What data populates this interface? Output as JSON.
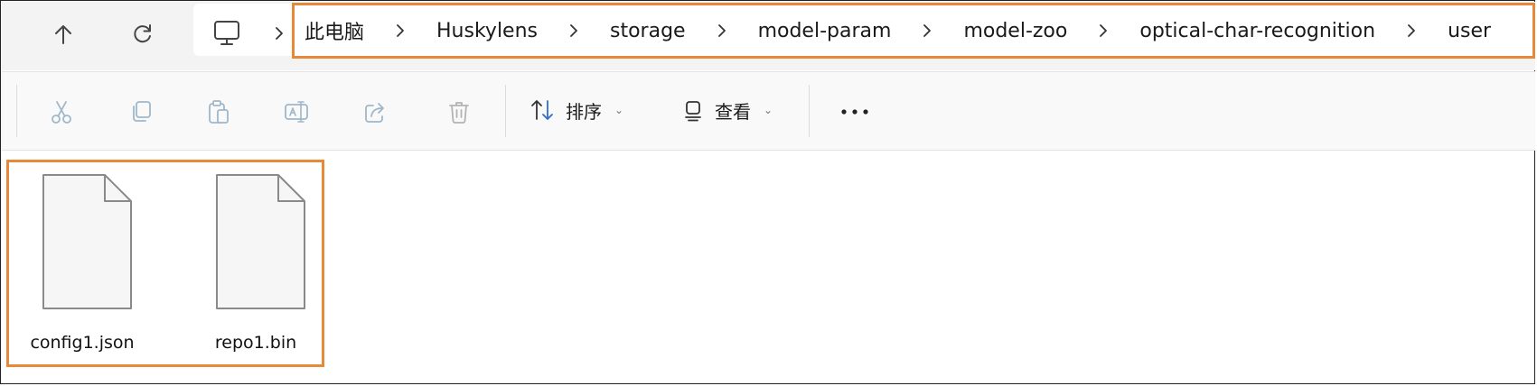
{
  "navigation": {
    "up_icon": "arrow-up-icon",
    "refresh_icon": "refresh-icon",
    "computer_icon": "computer-icon"
  },
  "breadcrumb": [
    "此电脑",
    "Huskylens",
    "storage",
    "model-param",
    "model-zoo",
    "optical-char-recognition",
    "user"
  ],
  "toolbar": {
    "icons": [
      "cut-icon",
      "copy-icon",
      "paste-icon",
      "rename-icon",
      "share-icon",
      "delete-icon"
    ],
    "sort_label": "排序",
    "view_label": "查看",
    "more_label": "···"
  },
  "files": [
    {
      "name": "config1.json",
      "icon": "file-icon"
    },
    {
      "name": "repo1.bin",
      "icon": "file-icon"
    }
  ],
  "colors": {
    "highlight": "#e8893a",
    "disabled_icon": "#9fb7c9",
    "nav_bg": "#f3f3f3"
  }
}
